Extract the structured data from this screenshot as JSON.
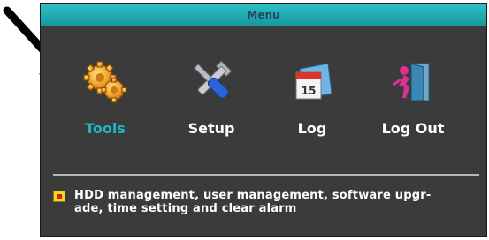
{
  "menu": {
    "title": "Menu",
    "items": [
      {
        "label": "Tools",
        "icon": "gears-icon",
        "active": true
      },
      {
        "label": "Setup",
        "icon": "wrench-screwdriver-icon",
        "active": false
      },
      {
        "label": "Log",
        "icon": "calendar-log-icon",
        "active": false
      },
      {
        "label": "Log Out",
        "icon": "logout-door-icon",
        "active": false
      }
    ],
    "description": "HDD management, user management, software upgr-\nade, time setting and clear alarm"
  },
  "colors": {
    "titlebar": "#1fa9b0",
    "panel_bg": "#3b3b3b",
    "active_label": "#1db5c0",
    "label": "#ffffff",
    "bullet": "#f3d71a"
  }
}
